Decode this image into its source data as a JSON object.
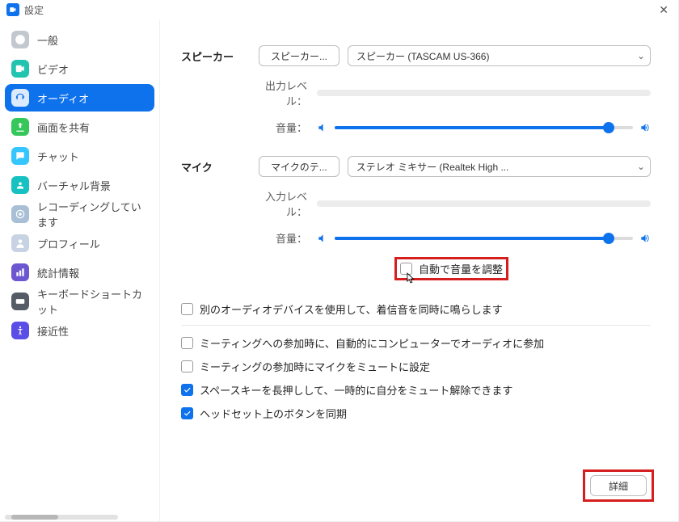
{
  "window": {
    "title": "設定"
  },
  "sidebar": {
    "items": [
      {
        "label": "一般"
      },
      {
        "label": "ビデオ"
      },
      {
        "label": "オーディオ"
      },
      {
        "label": "画面を共有"
      },
      {
        "label": "チャット"
      },
      {
        "label": "バーチャル背景"
      },
      {
        "label": "レコーディングしています"
      },
      {
        "label": "プロフィール"
      },
      {
        "label": "統計情報"
      },
      {
        "label": "キーボードショートカット"
      },
      {
        "label": "接近性"
      }
    ],
    "active_index": 2
  },
  "audio": {
    "speaker": {
      "heading": "スピーカー",
      "test_button": "スピーカー...",
      "device": "スピーカー (TASCAM US-366)",
      "output_level_label": "出力レベル：",
      "volume_label": "音量：",
      "volume_pct": 92
    },
    "mic": {
      "heading": "マイク",
      "test_button": "マイクのテ...",
      "device": "ステレオ ミキサー (Realtek High ...",
      "input_level_label": "入力レベル：",
      "volume_label": "音量：",
      "volume_pct": 92,
      "auto_adjust": {
        "label": "自動で音量を調整",
        "checked": false
      }
    },
    "options": {
      "ring_separate": {
        "label": "別のオーディオデバイスを使用して、着信音を同時に鳴らします",
        "checked": false
      },
      "auto_join_audio": {
        "label": "ミーティングへの参加時に、自動的にコンピューターでオーディオに参加",
        "checked": false
      },
      "mute_on_join": {
        "label": "ミーティングの参加時にマイクをミュートに設定",
        "checked": false
      },
      "space_unmute": {
        "label": "スペースキーを長押しして、一時的に自分をミュート解除できます",
        "checked": true
      },
      "headset_sync": {
        "label": "ヘッドセット上のボタンを同期",
        "checked": true
      }
    },
    "advanced_button": "詳細"
  }
}
